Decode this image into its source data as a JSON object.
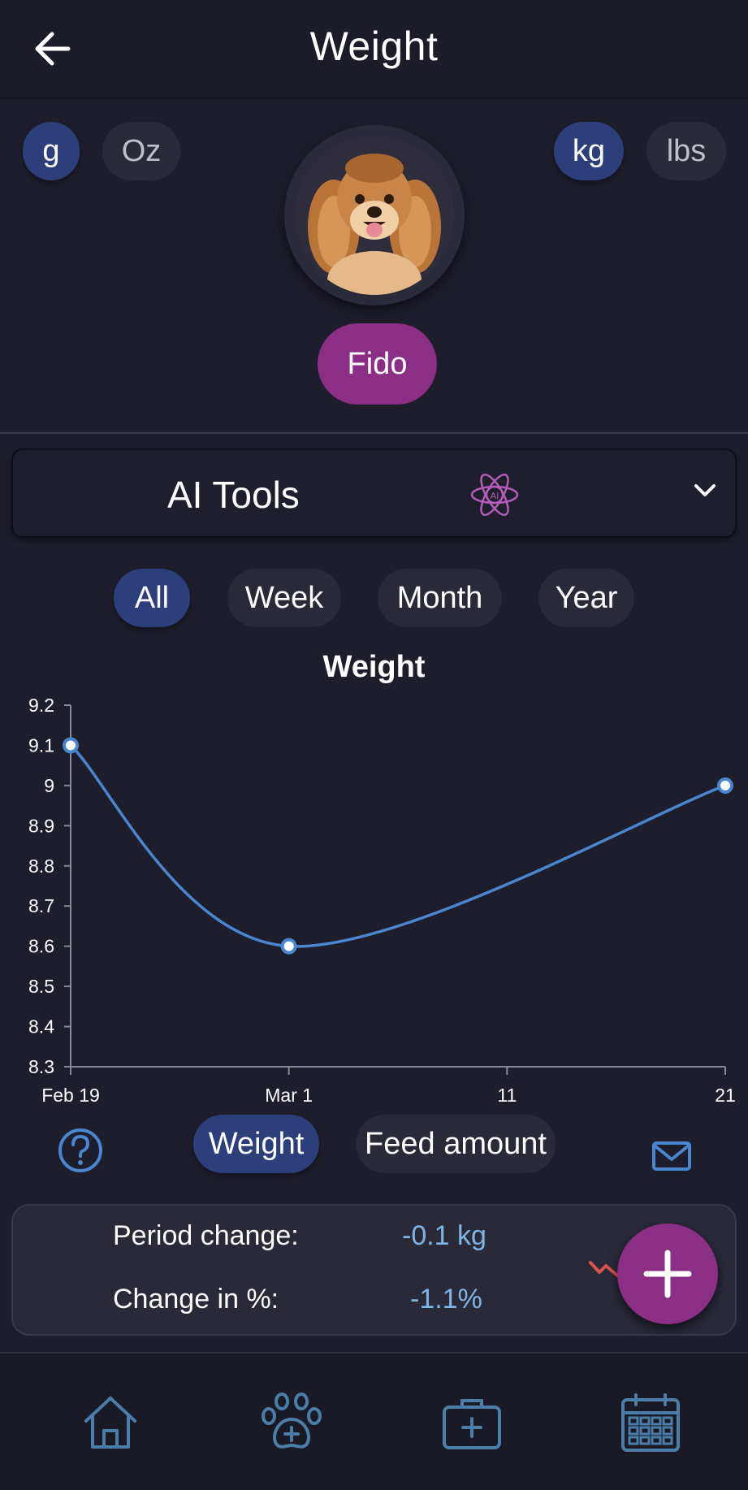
{
  "header": {
    "title": "Weight",
    "back_icon": "arrow-left-icon"
  },
  "units": {
    "small": [
      {
        "label": "g",
        "active": true
      },
      {
        "label": "Oz",
        "active": false
      }
    ],
    "large": [
      {
        "label": "kg",
        "active": true
      },
      {
        "label": "lbs",
        "active": false
      }
    ]
  },
  "pet": {
    "name": "Fido",
    "avatar": "cocker-spaniel-avatar"
  },
  "ai_tools": {
    "label": "AI Tools",
    "icon": "ai-atom-icon",
    "chevron": "chevron-down-icon"
  },
  "ranges": [
    {
      "label": "All",
      "active": true
    },
    {
      "label": "Week",
      "active": false
    },
    {
      "label": "Month",
      "active": false
    },
    {
      "label": "Year",
      "active": false
    }
  ],
  "chart_data": {
    "type": "line",
    "title": "Weight",
    "x": [
      "Feb 19",
      "Mar 1",
      "Mar 21"
    ],
    "x_ticks": [
      "Feb 19",
      "Mar 1",
      "11",
      "21"
    ],
    "series": [
      {
        "values": [
          9.1,
          8.6,
          9.0
        ]
      }
    ],
    "ylim": [
      8.3,
      9.2
    ],
    "y_ticks": [
      "9.2",
      "9.1",
      "9",
      "8.9",
      "8.8",
      "8.7",
      "8.6",
      "8.5",
      "8.4",
      "8.3"
    ],
    "colors": {
      "line": "#4a86d0",
      "axis": "#8a8a96"
    }
  },
  "metric_toggle": [
    {
      "label": "Weight",
      "active": true
    },
    {
      "label": "Feed amount",
      "active": false
    }
  ],
  "stats": {
    "period_change_label": "Period change:",
    "period_change_value": "-0.1 kg",
    "percent_change_label": "Change in %:",
    "percent_change_value": "-1.1%"
  },
  "fab": {
    "icon": "plus-icon"
  },
  "nav": [
    {
      "name": "home",
      "icon": "home-icon"
    },
    {
      "name": "pet",
      "icon": "paw-plus-icon"
    },
    {
      "name": "medical",
      "icon": "first-aid-kit-icon"
    },
    {
      "name": "calendar",
      "icon": "calendar-icon"
    }
  ],
  "colors": {
    "accent": "#8b2f86",
    "active_pill": "#2c3f7a",
    "background": "#1e1d2b",
    "value_text": "#7fb6e6"
  }
}
